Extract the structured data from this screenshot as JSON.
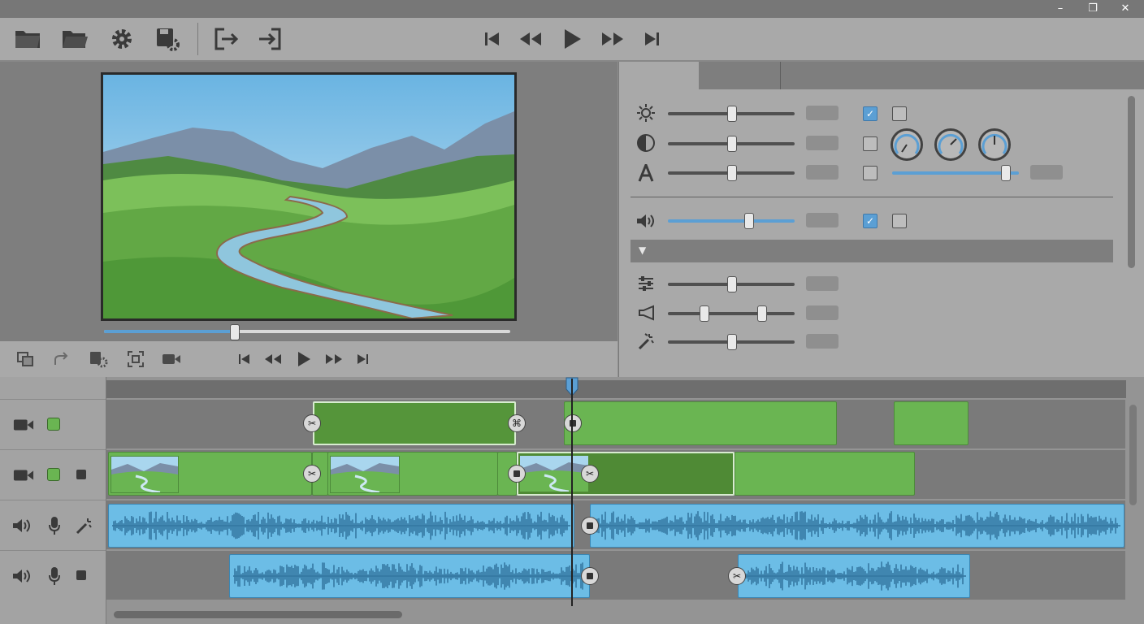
{
  "window": {
    "controls": [
      "minimize-icon",
      "restore-icon",
      "close-icon"
    ]
  },
  "toolbar": {
    "left_icons": [
      "open-folder-icon",
      "open-folder-alt-icon",
      "settings-gear-icon",
      "save-settings-icon",
      "export-icon",
      "import-icon"
    ],
    "transport": [
      "skip-back-icon",
      "rewind-icon",
      "play-icon",
      "fast-forward-icon",
      "skip-forward-icon"
    ]
  },
  "preview": {
    "scrub_progress": 0.32
  },
  "preview_controls": {
    "left_icons": [
      "duplicate-icon",
      "redo-icon",
      "clip-settings-icon",
      "fit-frame-icon",
      "camera-icon"
    ],
    "transport": [
      "skip-back-icon",
      "rewind-icon",
      "play-icon",
      "fast-forward-icon",
      "skip-forward-icon"
    ]
  },
  "inspector": {
    "tabs": [
      "",
      ""
    ],
    "rows_top": [
      {
        "icon": "brightness-icon",
        "slider": 0.5,
        "checks": [
          true,
          false
        ]
      },
      {
        "icon": "contrast-icon",
        "slider": 0.5,
        "checks": [
          false
        ]
      },
      {
        "icon": "text-a-icon",
        "slider": 0.5,
        "checks": [
          false
        ],
        "extra_slider": 0.9
      }
    ],
    "knobs": [
      "knob-1",
      "knob-2",
      "knob-3"
    ],
    "volume_row": {
      "icon": "volume-icon",
      "slider": 0.65,
      "checks": [
        true,
        false
      ]
    },
    "section_collapsed": "",
    "rows_bottom": [
      {
        "icon": "equalizer-icon",
        "slider": 0.5
      },
      {
        "icon": "speaker-range-icon",
        "range": [
          0.28,
          0.74
        ]
      },
      {
        "icon": "magic-wand-icon",
        "slider": 0.5
      }
    ]
  },
  "timeline": {
    "tracks": [
      {
        "type": "video",
        "icons": [
          "camera-icon",
          "enabled-dot-icon"
        ]
      },
      {
        "type": "video",
        "icons": [
          "camera-icon",
          "enabled-dot-icon",
          "lock-square-icon"
        ]
      },
      {
        "type": "audio",
        "icons": [
          "speaker-icon",
          "microphone-icon",
          "effects-wand-icon"
        ]
      },
      {
        "type": "audio",
        "icons": [
          "speaker-icon",
          "microphone-icon",
          "lock-square-icon"
        ]
      }
    ]
  },
  "colors": {
    "clip_green": "#6ab552",
    "clip_green_selected": "#4f8a35",
    "clip_audio": "#6cbde6",
    "accent_blue": "#5b9fd4",
    "playhead_marker": "#5b9fd4"
  }
}
